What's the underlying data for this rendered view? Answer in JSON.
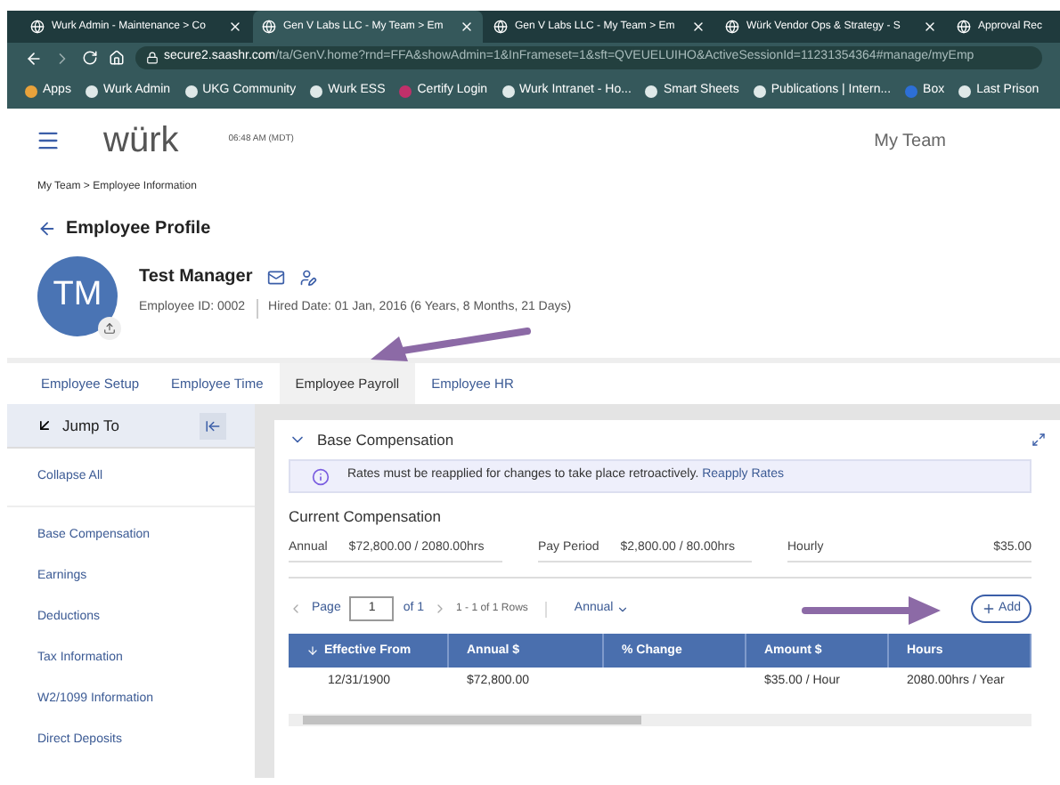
{
  "browser": {
    "tabs": [
      {
        "title": "Wurk Admin - Maintenance > Co",
        "selected": false
      },
      {
        "title": "Gen V Labs LLC - My Team > Em",
        "selected": true
      },
      {
        "title": "Gen V Labs LLC - My Team > Em",
        "selected": false
      },
      {
        "title": "Würk Vendor Ops & Strategy - S",
        "selected": false
      },
      {
        "title": "Approval Rec",
        "selected": false
      }
    ],
    "url_host": "secure2.saashr.com",
    "url_path": "/ta/GenV.home?rnd=FFA&showAdmin=1&InFrameset=1&sft=QVEUELUIHO&ActiveSessionId=11231354364#manage/myEmp",
    "bookmarks": [
      "Apps",
      "Wurk Admin",
      "UKG Community",
      "Wurk ESS",
      "Certify Login",
      "Wurk Intranet - Ho...",
      "Smart Sheets",
      "Publications | Intern...",
      "Box",
      "Last Prison"
    ]
  },
  "header": {
    "logo": "würk",
    "time": "06:48 AM (MDT)",
    "title": "My Team"
  },
  "breadcrumb": "My Team > Employee Information",
  "page_title": "Employee Profile",
  "employee": {
    "initials": "TM",
    "name": "Test Manager",
    "id": "Employee ID: 0002",
    "hired": "Hired Date: 01 Jan, 2016 (6 Years, 8 Months, 21 Days)"
  },
  "tabs": [
    {
      "label": "Employee Setup",
      "selected": false
    },
    {
      "label": "Employee Time",
      "selected": false
    },
    {
      "label": "Employee Payroll",
      "selected": true
    },
    {
      "label": "Employee HR",
      "selected": false
    }
  ],
  "sidebar": {
    "title": "Jump To",
    "collapse": "Collapse All",
    "items": [
      "Base Compensation",
      "Earnings",
      "Deductions",
      "Tax Information",
      "W2/1099 Information",
      "Direct Deposits"
    ]
  },
  "section": {
    "title": "Base Compensation",
    "notice": "Rates must be reapplied for changes to take place retroactively.",
    "notice_link": "Reapply Rates",
    "current_title": "Current Compensation",
    "current": [
      {
        "label": "Annual",
        "value": "$72,800.00 / 2080.00hrs"
      },
      {
        "label": "Pay Period",
        "value": "$2,800.00 / 80.00hrs"
      },
      {
        "label": "Hourly",
        "value": "$35.00"
      }
    ],
    "pager": {
      "page_label": "Page",
      "page": "1",
      "of": "of 1",
      "rows": "1 - 1 of 1 Rows",
      "period": "Annual"
    },
    "add": "Add",
    "columns": [
      "Effective From",
      "Annual $",
      "% Change",
      "Amount $",
      "Hours"
    ],
    "rows": [
      {
        "effective_from": "12/31/1900",
        "annual": "$72,800.00",
        "amount": "$35.00 / Hour",
        "hours": "2080.00hrs / Year"
      }
    ]
  }
}
